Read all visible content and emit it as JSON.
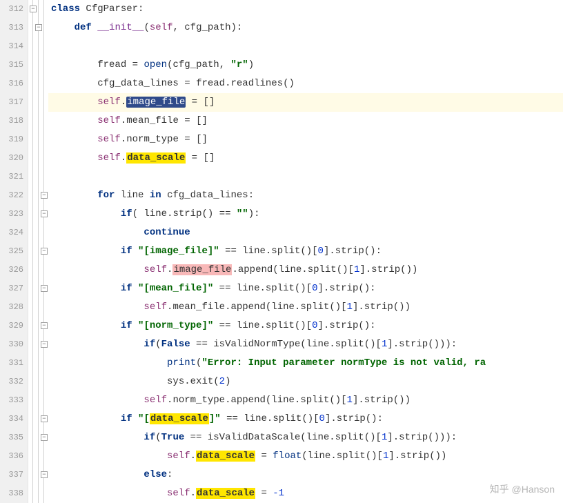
{
  "watermark": "知乎 @Hanson",
  "highlight_line_index": 5,
  "lines": [
    {
      "num": 312,
      "indent": 0,
      "tokens": [
        {
          "t": "kw",
          "v": "class"
        },
        {
          "t": "sp",
          "v": " "
        },
        {
          "t": "id",
          "v": "CfgParser"
        },
        {
          "t": "op",
          "v": ":"
        }
      ]
    },
    {
      "num": 313,
      "indent": 1,
      "tokens": [
        {
          "t": "kw",
          "v": "def"
        },
        {
          "t": "sp",
          "v": " "
        },
        {
          "t": "fn",
          "v": "__init__"
        },
        {
          "t": "op",
          "v": "("
        },
        {
          "t": "self",
          "v": "self"
        },
        {
          "t": "op",
          "v": ", "
        },
        {
          "t": "id",
          "v": "cfg_path"
        },
        {
          "t": "op",
          "v": "):"
        }
      ]
    },
    {
      "num": 314,
      "indent": 0,
      "tokens": []
    },
    {
      "num": 315,
      "indent": 2,
      "tokens": [
        {
          "t": "id",
          "v": "fread"
        },
        {
          "t": "op",
          "v": " = "
        },
        {
          "t": "builtin",
          "v": "open"
        },
        {
          "t": "op",
          "v": "("
        },
        {
          "t": "id",
          "v": "cfg_path"
        },
        {
          "t": "op",
          "v": ", "
        },
        {
          "t": "str",
          "v": "\"r\""
        },
        {
          "t": "op",
          "v": ")"
        }
      ]
    },
    {
      "num": 316,
      "indent": 2,
      "tokens": [
        {
          "t": "id",
          "v": "cfg_data_lines"
        },
        {
          "t": "op",
          "v": " = "
        },
        {
          "t": "id",
          "v": "fread"
        },
        {
          "t": "op",
          "v": "."
        },
        {
          "t": "id",
          "v": "readlines"
        },
        {
          "t": "op",
          "v": "()"
        }
      ]
    },
    {
      "num": 317,
      "indent": 2,
      "tokens": [
        {
          "t": "self",
          "v": "self"
        },
        {
          "t": "op",
          "v": "."
        },
        {
          "t": "hl-sel",
          "v": "image_file"
        },
        {
          "t": "op",
          "v": " = []"
        }
      ]
    },
    {
      "num": 318,
      "indent": 2,
      "tokens": [
        {
          "t": "self",
          "v": "self"
        },
        {
          "t": "op",
          "v": "."
        },
        {
          "t": "id",
          "v": "mean_file"
        },
        {
          "t": "op",
          "v": " = []"
        }
      ]
    },
    {
      "num": 319,
      "indent": 2,
      "tokens": [
        {
          "t": "self",
          "v": "self"
        },
        {
          "t": "op",
          "v": "."
        },
        {
          "t": "id",
          "v": "norm_type"
        },
        {
          "t": "op",
          "v": " = []"
        }
      ]
    },
    {
      "num": 320,
      "indent": 2,
      "tokens": [
        {
          "t": "self",
          "v": "self"
        },
        {
          "t": "op",
          "v": "."
        },
        {
          "t": "hl-yellow",
          "v": "data_scale"
        },
        {
          "t": "op",
          "v": " = []"
        }
      ]
    },
    {
      "num": 321,
      "indent": 0,
      "tokens": []
    },
    {
      "num": 322,
      "indent": 2,
      "tokens": [
        {
          "t": "kw",
          "v": "for"
        },
        {
          "t": "sp",
          "v": " "
        },
        {
          "t": "id",
          "v": "line"
        },
        {
          "t": "sp",
          "v": " "
        },
        {
          "t": "kw",
          "v": "in"
        },
        {
          "t": "sp",
          "v": " "
        },
        {
          "t": "id",
          "v": "cfg_data_lines"
        },
        {
          "t": "op",
          "v": ":"
        }
      ]
    },
    {
      "num": 323,
      "indent": 3,
      "tokens": [
        {
          "t": "kw",
          "v": "if"
        },
        {
          "t": "op",
          "v": "( "
        },
        {
          "t": "id",
          "v": "line"
        },
        {
          "t": "op",
          "v": "."
        },
        {
          "t": "id",
          "v": "strip"
        },
        {
          "t": "op",
          "v": "() == "
        },
        {
          "t": "str",
          "v": "\"\""
        },
        {
          "t": "op",
          "v": "):"
        }
      ]
    },
    {
      "num": 324,
      "indent": 4,
      "tokens": [
        {
          "t": "kw",
          "v": "continue"
        }
      ]
    },
    {
      "num": 325,
      "indent": 3,
      "tokens": [
        {
          "t": "kw",
          "v": "if"
        },
        {
          "t": "sp",
          "v": " "
        },
        {
          "t": "str",
          "v": "\"[image_file]\""
        },
        {
          "t": "op",
          "v": " == "
        },
        {
          "t": "id",
          "v": "line"
        },
        {
          "t": "op",
          "v": "."
        },
        {
          "t": "id",
          "v": "split"
        },
        {
          "t": "op",
          "v": "()["
        },
        {
          "t": "num",
          "v": "0"
        },
        {
          "t": "op",
          "v": "]."
        },
        {
          "t": "id",
          "v": "strip"
        },
        {
          "t": "op",
          "v": "():"
        }
      ]
    },
    {
      "num": 326,
      "indent": 4,
      "tokens": [
        {
          "t": "self",
          "v": "self"
        },
        {
          "t": "op",
          "v": "."
        },
        {
          "t": "hl-pink",
          "v": "image_file"
        },
        {
          "t": "op",
          "v": "."
        },
        {
          "t": "id",
          "v": "append"
        },
        {
          "t": "op",
          "v": "("
        },
        {
          "t": "id",
          "v": "line"
        },
        {
          "t": "op",
          "v": "."
        },
        {
          "t": "id",
          "v": "split"
        },
        {
          "t": "op",
          "v": "()["
        },
        {
          "t": "num",
          "v": "1"
        },
        {
          "t": "op",
          "v": "]."
        },
        {
          "t": "id",
          "v": "strip"
        },
        {
          "t": "op",
          "v": "())"
        }
      ]
    },
    {
      "num": 327,
      "indent": 3,
      "tokens": [
        {
          "t": "kw",
          "v": "if"
        },
        {
          "t": "sp",
          "v": " "
        },
        {
          "t": "str",
          "v": "\"[mean_file]\""
        },
        {
          "t": "op",
          "v": " == "
        },
        {
          "t": "id",
          "v": "line"
        },
        {
          "t": "op",
          "v": "."
        },
        {
          "t": "id",
          "v": "split"
        },
        {
          "t": "op",
          "v": "()["
        },
        {
          "t": "num",
          "v": "0"
        },
        {
          "t": "op",
          "v": "]."
        },
        {
          "t": "id",
          "v": "strip"
        },
        {
          "t": "op",
          "v": "():"
        }
      ]
    },
    {
      "num": 328,
      "indent": 4,
      "tokens": [
        {
          "t": "self",
          "v": "self"
        },
        {
          "t": "op",
          "v": "."
        },
        {
          "t": "id",
          "v": "mean_file"
        },
        {
          "t": "op",
          "v": "."
        },
        {
          "t": "id",
          "v": "append"
        },
        {
          "t": "op",
          "v": "("
        },
        {
          "t": "id",
          "v": "line"
        },
        {
          "t": "op",
          "v": "."
        },
        {
          "t": "id",
          "v": "split"
        },
        {
          "t": "op",
          "v": "()["
        },
        {
          "t": "num",
          "v": "1"
        },
        {
          "t": "op",
          "v": "]."
        },
        {
          "t": "id",
          "v": "strip"
        },
        {
          "t": "op",
          "v": "())"
        }
      ]
    },
    {
      "num": 329,
      "indent": 3,
      "tokens": [
        {
          "t": "kw",
          "v": "if"
        },
        {
          "t": "sp",
          "v": " "
        },
        {
          "t": "str",
          "v": "\"[norm_type]\""
        },
        {
          "t": "op",
          "v": " == "
        },
        {
          "t": "id",
          "v": "line"
        },
        {
          "t": "op",
          "v": "."
        },
        {
          "t": "id",
          "v": "split"
        },
        {
          "t": "op",
          "v": "()["
        },
        {
          "t": "num",
          "v": "0"
        },
        {
          "t": "op",
          "v": "]."
        },
        {
          "t": "id",
          "v": "strip"
        },
        {
          "t": "op",
          "v": "():"
        }
      ]
    },
    {
      "num": 330,
      "indent": 4,
      "tokens": [
        {
          "t": "kw",
          "v": "if"
        },
        {
          "t": "op",
          "v": "("
        },
        {
          "t": "bool",
          "v": "False"
        },
        {
          "t": "op",
          "v": " == "
        },
        {
          "t": "id",
          "v": "isValidNormType"
        },
        {
          "t": "op",
          "v": "("
        },
        {
          "t": "id",
          "v": "line"
        },
        {
          "t": "op",
          "v": "."
        },
        {
          "t": "id",
          "v": "split"
        },
        {
          "t": "op",
          "v": "()["
        },
        {
          "t": "num",
          "v": "1"
        },
        {
          "t": "op",
          "v": "]."
        },
        {
          "t": "id",
          "v": "strip"
        },
        {
          "t": "op",
          "v": "())):"
        }
      ]
    },
    {
      "num": 331,
      "indent": 5,
      "tokens": [
        {
          "t": "builtin",
          "v": "print"
        },
        {
          "t": "op",
          "v": "("
        },
        {
          "t": "str",
          "v": "\"Error: Input parameter normType is not valid, ra"
        }
      ]
    },
    {
      "num": 332,
      "indent": 5,
      "tokens": [
        {
          "t": "id",
          "v": "sys"
        },
        {
          "t": "op",
          "v": "."
        },
        {
          "t": "id",
          "v": "exit"
        },
        {
          "t": "op",
          "v": "("
        },
        {
          "t": "num",
          "v": "2"
        },
        {
          "t": "op",
          "v": ")"
        }
      ]
    },
    {
      "num": 333,
      "indent": 4,
      "tokens": [
        {
          "t": "self",
          "v": "self"
        },
        {
          "t": "op",
          "v": "."
        },
        {
          "t": "id",
          "v": "norm_type"
        },
        {
          "t": "op",
          "v": "."
        },
        {
          "t": "id",
          "v": "append"
        },
        {
          "t": "op",
          "v": "("
        },
        {
          "t": "id",
          "v": "line"
        },
        {
          "t": "op",
          "v": "."
        },
        {
          "t": "id",
          "v": "split"
        },
        {
          "t": "op",
          "v": "()["
        },
        {
          "t": "num",
          "v": "1"
        },
        {
          "t": "op",
          "v": "]."
        },
        {
          "t": "id",
          "v": "strip"
        },
        {
          "t": "op",
          "v": "())"
        }
      ]
    },
    {
      "num": 334,
      "indent": 3,
      "tokens": [
        {
          "t": "kw",
          "v": "if"
        },
        {
          "t": "sp",
          "v": " "
        },
        {
          "t": "str",
          "v": "\"["
        },
        {
          "t": "hl-yellow",
          "v": "data_scale"
        },
        {
          "t": "str",
          "v": "]\""
        },
        {
          "t": "op",
          "v": " == "
        },
        {
          "t": "id",
          "v": "line"
        },
        {
          "t": "op",
          "v": "."
        },
        {
          "t": "id",
          "v": "split"
        },
        {
          "t": "op",
          "v": "()["
        },
        {
          "t": "num",
          "v": "0"
        },
        {
          "t": "op",
          "v": "]."
        },
        {
          "t": "id",
          "v": "strip"
        },
        {
          "t": "op",
          "v": "():"
        }
      ]
    },
    {
      "num": 335,
      "indent": 4,
      "tokens": [
        {
          "t": "kw",
          "v": "if"
        },
        {
          "t": "op",
          "v": "("
        },
        {
          "t": "bool",
          "v": "True"
        },
        {
          "t": "op",
          "v": " == "
        },
        {
          "t": "id",
          "v": "isValidDataScale"
        },
        {
          "t": "op",
          "v": "("
        },
        {
          "t": "id",
          "v": "line"
        },
        {
          "t": "op",
          "v": "."
        },
        {
          "t": "id",
          "v": "split"
        },
        {
          "t": "op",
          "v": "()["
        },
        {
          "t": "num",
          "v": "1"
        },
        {
          "t": "op",
          "v": "]."
        },
        {
          "t": "id",
          "v": "strip"
        },
        {
          "t": "op",
          "v": "())):"
        }
      ]
    },
    {
      "num": 336,
      "indent": 5,
      "tokens": [
        {
          "t": "self",
          "v": "self"
        },
        {
          "t": "op",
          "v": "."
        },
        {
          "t": "hl-yellow",
          "v": "data_scale"
        },
        {
          "t": "op",
          "v": " = "
        },
        {
          "t": "builtin",
          "v": "float"
        },
        {
          "t": "op",
          "v": "("
        },
        {
          "t": "id",
          "v": "line"
        },
        {
          "t": "op",
          "v": "."
        },
        {
          "t": "id",
          "v": "split"
        },
        {
          "t": "op",
          "v": "()["
        },
        {
          "t": "num",
          "v": "1"
        },
        {
          "t": "op",
          "v": "]."
        },
        {
          "t": "id",
          "v": "strip"
        },
        {
          "t": "op",
          "v": "())"
        }
      ]
    },
    {
      "num": 337,
      "indent": 4,
      "tokens": [
        {
          "t": "kw",
          "v": "else"
        },
        {
          "t": "op",
          "v": ":"
        }
      ]
    },
    {
      "num": 338,
      "indent": 5,
      "tokens": [
        {
          "t": "self",
          "v": "self"
        },
        {
          "t": "op",
          "v": "."
        },
        {
          "t": "hl-yellow",
          "v": "data_scale"
        },
        {
          "t": "op",
          "v": " = "
        },
        {
          "t": "num",
          "v": "-1"
        }
      ]
    }
  ],
  "fold_boxes": [
    {
      "row": 0,
      "col": 1
    },
    {
      "row": 1,
      "col": 2
    },
    {
      "row": 10,
      "col": 3
    },
    {
      "row": 11,
      "col": 3
    },
    {
      "row": 13,
      "col": 3
    },
    {
      "row": 15,
      "col": 3
    },
    {
      "row": 17,
      "col": 3
    },
    {
      "row": 18,
      "col": 3
    },
    {
      "row": 22,
      "col": 3
    },
    {
      "row": 23,
      "col": 3
    },
    {
      "row": 25,
      "col": 3
    }
  ]
}
